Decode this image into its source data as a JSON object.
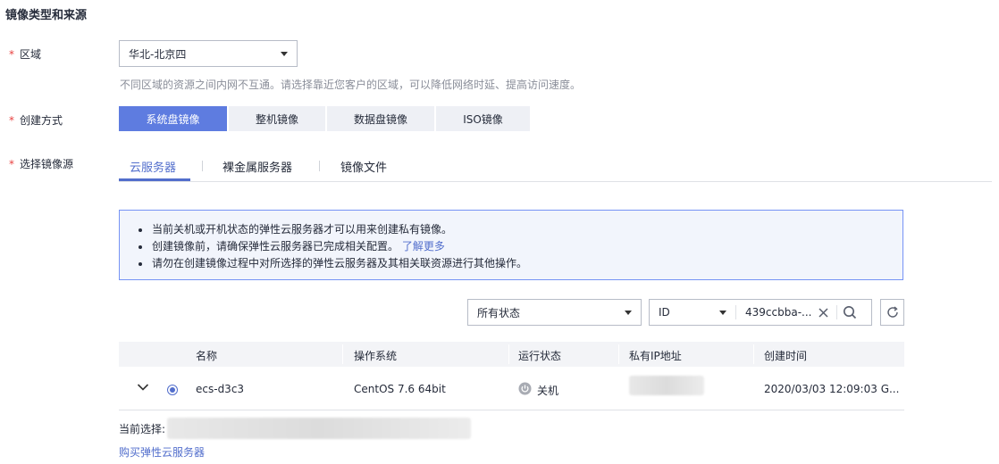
{
  "section_title": "镜像类型和来源",
  "region": {
    "label": "区域",
    "value": "华北-北京四",
    "hint": "不同区域的资源之间内网不互通。请选择靠近您客户的区域，可以降低网络时延、提高访问速度。"
  },
  "create_method": {
    "label": "创建方式",
    "options": [
      "系统盘镜像",
      "整机镜像",
      "数据盘镜像",
      "ISO镜像"
    ],
    "selected": "系统盘镜像"
  },
  "source": {
    "label": "选择镜像源",
    "tabs": [
      "云服务器",
      "裸金属服务器",
      "镜像文件"
    ],
    "active_tab": "云服务器"
  },
  "info": {
    "line1": "当前关机或开机状态的弹性云服务器才可以用来创建私有镜像。",
    "line2": "创建镜像前，请确保弹性云服务器已完成相关配置。",
    "line2_link": "了解更多",
    "line3": "请勿在创建镜像过程中对所选择的弹性云服务器及其相关联资源进行其他操作。"
  },
  "filter": {
    "status_value": "所有状态",
    "field_value": "ID",
    "search_value": "439ccbba-..."
  },
  "table": {
    "columns": [
      "名称",
      "操作系统",
      "运行状态",
      "私有IP地址",
      "创建时间"
    ],
    "rows": [
      {
        "name": "ecs-d3c3",
        "os": "CentOS 7.6 64bit",
        "status": "关机",
        "created": "2020/03/03 12:09:03 G..."
      }
    ]
  },
  "current_selection_label": "当前选择: ",
  "buy_link": "购买弹性云服务器",
  "colors": {
    "accent": "#5e7ce0",
    "link": "#526ecc",
    "required": "#e8403f"
  }
}
